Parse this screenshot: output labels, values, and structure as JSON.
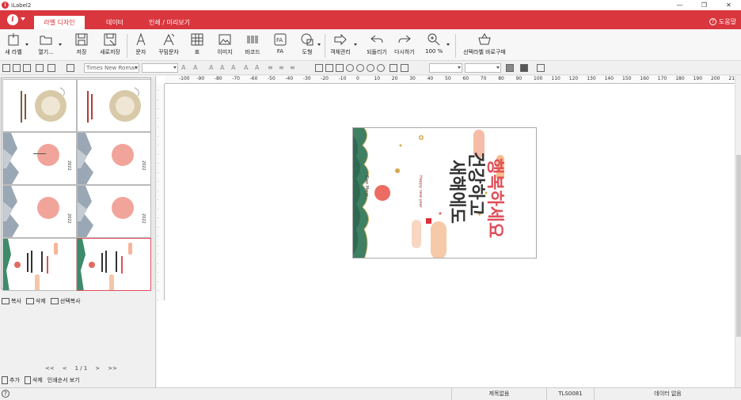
{
  "window": {
    "title": "iLabel2",
    "minimize": "—",
    "restore": "❐",
    "close": "✕"
  },
  "ribbon": {
    "tabs": [
      "라벨 디자인",
      "데이터",
      "인쇄 / 미리보기"
    ],
    "active_tab": "라벨 디자인",
    "help": "도움말",
    "accent_color": "#d9363e"
  },
  "toolbar": {
    "items": [
      "새 라벨",
      "열기...",
      "저장",
      "새로저장",
      "문자",
      "꾸밈문자",
      "표",
      "이미지",
      "바코드",
      "FA",
      "도형",
      "객체관리",
      "되돌리기",
      "다시하기",
      "100 %",
      "선택라벨 바로구매"
    ]
  },
  "format": {
    "font_name": "Times New Roman",
    "font_size": ""
  },
  "thumbnails": {
    "count": 8,
    "selected_index": 6
  },
  "left_actions": {
    "copy": "복사",
    "delete": "삭제",
    "select_copy": "선택복사"
  },
  "pager": {
    "first": "<<",
    "prev": "<",
    "page": "1 / 1",
    "next": ">",
    "last": ">>"
  },
  "left_bottom": {
    "add": "추가",
    "delete": "삭제",
    "print_order": "인쇄순서 보기"
  },
  "ruler": {
    "h_labels": [
      "-100",
      "-90",
      "-80",
      "-70",
      "-60",
      "-50",
      "-40",
      "-30",
      "-20",
      "-10",
      "0",
      "10",
      "20",
      "30",
      "40",
      "50",
      "60",
      "70",
      "80",
      "90",
      "100",
      "110",
      "120",
      "130",
      "140",
      "150",
      "160",
      "170",
      "180",
      "190",
      "200",
      "210"
    ],
    "v_labels": [
      "0",
      "10",
      "20",
      "30",
      "40",
      "50",
      "60",
      "70",
      "80",
      "90",
      "100",
      "110",
      "120",
      "130",
      "140",
      "150",
      "160",
      "170",
      "180",
      "190",
      "200",
      "210",
      "220",
      "230"
    ]
  },
  "label": {
    "headline_lines": [
      "새해에도",
      "건강하고",
      "행복하세요"
    ],
    "small_line": "Happy new year",
    "side_text": "Ciao Mano",
    "ornament_star": "✦"
  },
  "status": {
    "help": "?",
    "title": "제목없음",
    "code": "TLS0081",
    "data": "데이터 없음"
  }
}
